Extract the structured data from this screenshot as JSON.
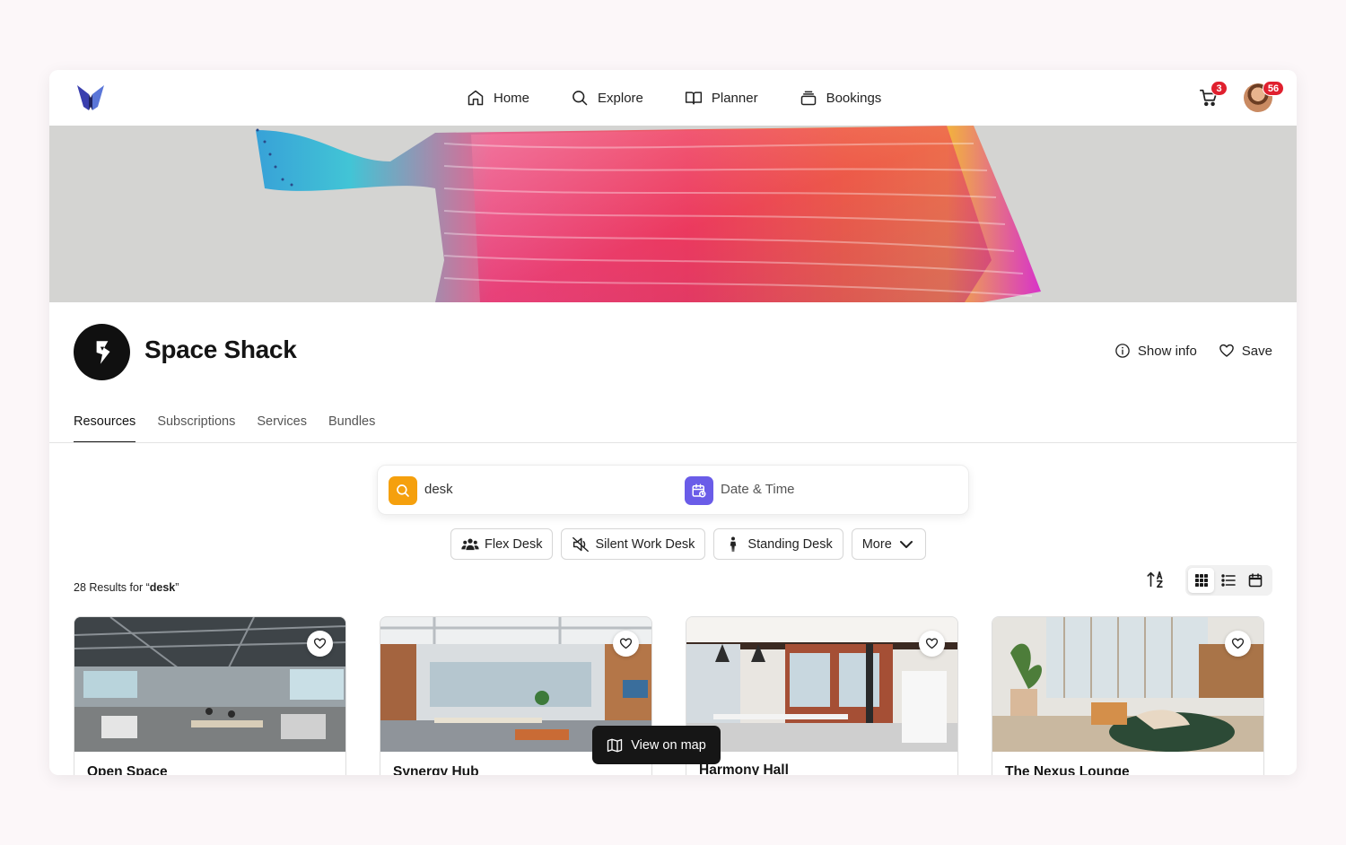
{
  "nav": {
    "items": [
      {
        "label": "Home",
        "icon": "home-icon"
      },
      {
        "label": "Explore",
        "icon": "search-icon"
      },
      {
        "label": "Planner",
        "icon": "book-icon"
      },
      {
        "label": "Bookings",
        "icon": "stack-icon"
      }
    ],
    "cart_count": "3",
    "notification_count": "56"
  },
  "org": {
    "name": "Space Shack",
    "show_info": "Show info",
    "save": "Save"
  },
  "tabs": [
    "Resources",
    "Subscriptions",
    "Services",
    "Bundles"
  ],
  "search": {
    "query": "desk",
    "date_time": "Date & Time"
  },
  "chips": [
    {
      "label": "Flex Desk",
      "icon": "people-icon"
    },
    {
      "label": "Silent Work Desk",
      "icon": "mute-icon"
    },
    {
      "label": "Standing Desk",
      "icon": "standing-person-icon"
    },
    {
      "label": "More",
      "icon": "chevron-down-icon"
    }
  ],
  "results": {
    "prefix": "28 Results for “",
    "query": "desk",
    "suffix": "”"
  },
  "cards": [
    {
      "title": "Open Space"
    },
    {
      "title": "Synergy Hub"
    },
    {
      "title": "Harmony Hall"
    },
    {
      "title": "The Nexus Lounge"
    }
  ],
  "map_button": "View on map",
  "colors": {
    "search_accent": "#f5a00d",
    "date_accent": "#6a5ce8",
    "badge": "#e0202e"
  }
}
